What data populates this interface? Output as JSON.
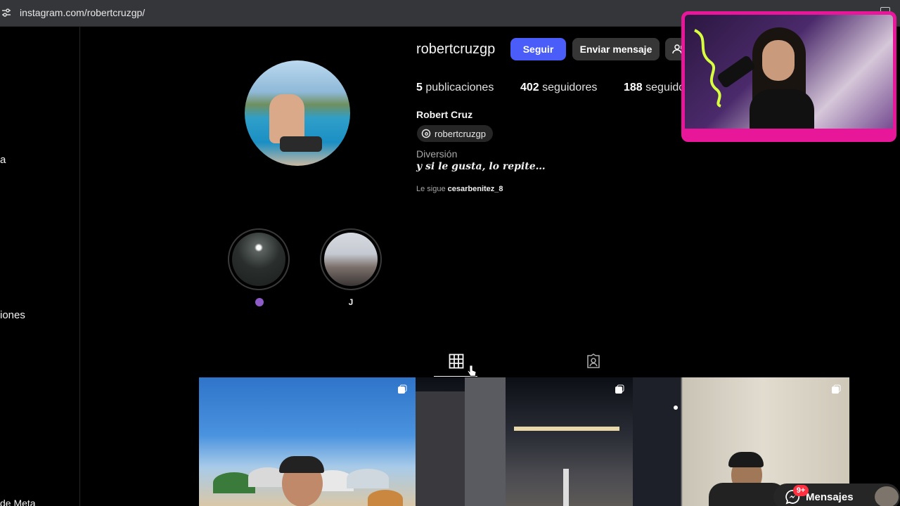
{
  "browser": {
    "url": "instagram.com/robertcruzgp/"
  },
  "sidebar": {
    "fragments": [
      "a",
      "iones",
      "de Meta"
    ]
  },
  "profile": {
    "username": "robertcruzgp",
    "follow_label": "Seguir",
    "message_label": "Enviar mensaje",
    "stats": {
      "posts_count": "5",
      "posts_label": "publicaciones",
      "followers_count": "402",
      "followers_label": "seguidores",
      "following_count": "188",
      "following_label": "seguido"
    },
    "full_name": "Robert Cruz",
    "threads_handle": "robertcruzgp",
    "category": "Diversión",
    "bio": "y si le gusta, lo repite…",
    "followed_by_prefix": "Le sigue",
    "followed_by_user": "cesarbenitez_8"
  },
  "highlights": [
    {
      "label": ""
    },
    {
      "label": "J"
    }
  ],
  "messages": {
    "label": "Mensajes",
    "badge": "9+"
  },
  "colors": {
    "follow_button": "#4a5df9",
    "secondary_button": "#363636",
    "badge": "#ff3040",
    "overlay_frame": "#e8179a"
  }
}
